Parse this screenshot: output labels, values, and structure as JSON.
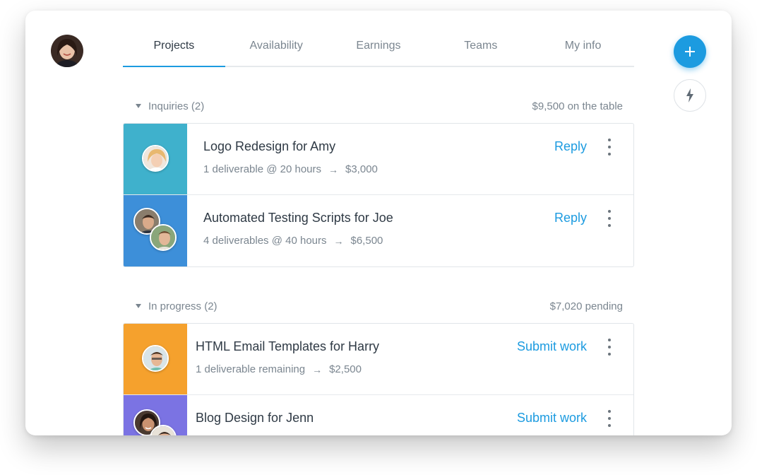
{
  "nav": {
    "tabs": [
      {
        "label": "Projects",
        "active": true
      },
      {
        "label": "Availability",
        "active": false
      },
      {
        "label": "Earnings",
        "active": false
      },
      {
        "label": "Teams",
        "active": false
      },
      {
        "label": "My info",
        "active": false
      }
    ]
  },
  "actions": {
    "add_icon": "plus-icon",
    "bolt_icon": "lightning-icon"
  },
  "sections": [
    {
      "title": "Inquiries (2)",
      "summary": "$9,500 on the table",
      "items": [
        {
          "title": "Logo Redesign for Amy",
          "details": "1 deliverable @ 20 hours",
          "amount": "$3,000",
          "action": "Reply",
          "color": "#3fb1cc"
        },
        {
          "title": "Automated Testing Scripts for Joe",
          "details": "4 deliverables @ 40 hours",
          "amount": "$6,500",
          "action": "Reply",
          "color": "#3d8fd9"
        }
      ]
    },
    {
      "title": "In progress (2)",
      "summary": "$7,020 pending",
      "items": [
        {
          "title": "HTML Email Templates for Harry",
          "details": "1 deliverable remaining",
          "amount": "$2,500",
          "action": "Submit work",
          "color": "#f5a12d"
        },
        {
          "title": "Blog Design for Jenn",
          "details": "",
          "amount": "",
          "action": "Submit work",
          "color": "#7b73e3"
        }
      ]
    }
  ]
}
